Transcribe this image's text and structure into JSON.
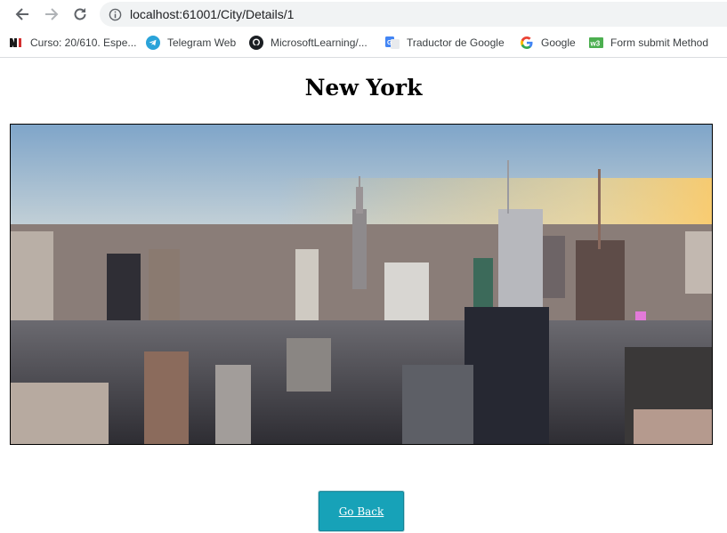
{
  "browser": {
    "url": "localhost:61001/City/Details/1",
    "bookmarks": [
      {
        "label": "Curso: 20/610. Espe...",
        "icon": "ni-logo-icon"
      },
      {
        "label": "Telegram Web",
        "icon": "telegram-icon"
      },
      {
        "label": "MicrosoftLearning/...",
        "icon": "github-icon"
      },
      {
        "label": "Traductor de Google",
        "icon": "google-translate-icon"
      },
      {
        "label": "Google",
        "icon": "google-icon"
      },
      {
        "label": "Form submit Method",
        "icon": "w3schools-icon"
      }
    ]
  },
  "page": {
    "title": "New York",
    "image_description_icon": "city-skyline-image",
    "go_back_label": "Go Back",
    "colors": {
      "button": "#17a2b8",
      "border": "#000000"
    }
  }
}
